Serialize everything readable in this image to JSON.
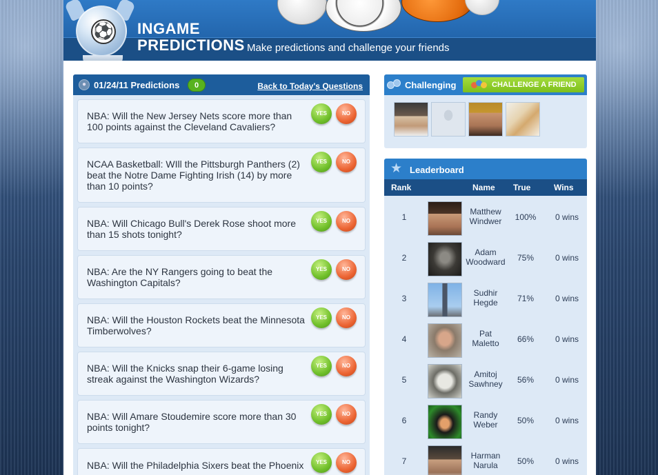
{
  "header": {
    "title_line1": "INGAME",
    "title_line2": "PREDICTIONS",
    "tagline": "Make predictions and challenge your friends"
  },
  "predictions": {
    "date_title": "01/24/11 Predictions",
    "count": "0",
    "back_link": "Back to Today's Questions",
    "yes_label": "YES",
    "no_label": "NO",
    "questions": [
      {
        "text": "NBA: Will the New Jersey Nets score more than 100 points against the Cleveland Cavaliers?"
      },
      {
        "text": "NCAA Basketball: WIll the Pittsburgh Panthers (2) beat the Notre Dame Fighting Irish (14) by more than 10 points?"
      },
      {
        "text": "NBA: Will Chicago Bull's Derek Rose shoot more than 15 shots tonight?"
      },
      {
        "text": "NBA: Are the NY Rangers going to beat the Washington Capitals?"
      },
      {
        "text": "NBA: Will the Houston Rockets beat the Minnesota Timberwolves?"
      },
      {
        "text": "NBA: Will the Knicks snap their 6-game losing streak against the Washington Wizards?"
      },
      {
        "text": "NBA: Will Amare Stoudemire score more than 30 points tonight?"
      },
      {
        "text": "NBA: Will the Philadelphia Sixers beat the Phoenix"
      }
    ]
  },
  "challenging": {
    "title": "Challenging",
    "button": "CHALLENGE A FRIEND",
    "friends": [
      "friend-1",
      "friend-2",
      "friend-3",
      "friend-4"
    ]
  },
  "leaderboard": {
    "title": "Leaderboard",
    "columns": {
      "rank": "Rank",
      "name": "Name",
      "true": "True",
      "wins": "Wins"
    },
    "rows": [
      {
        "rank": "1",
        "name": "Matthew Windwer",
        "pct": "100%",
        "wins": "0 wins"
      },
      {
        "rank": "2",
        "name": "Adam Woodward",
        "pct": "75%",
        "wins": "0 wins"
      },
      {
        "rank": "3",
        "name": "Sudhir Hegde",
        "pct": "71%",
        "wins": "0 wins"
      },
      {
        "rank": "4",
        "name": "Pat Maletto",
        "pct": "66%",
        "wins": "0 wins"
      },
      {
        "rank": "5",
        "name": "Amitoj Sawhney",
        "pct": "56%",
        "wins": "0 wins"
      },
      {
        "rank": "6",
        "name": "Randy Weber",
        "pct": "50%",
        "wins": "0 wins"
      },
      {
        "rank": "7",
        "name": "Harman Narula",
        "pct": "50%",
        "wins": "0 wins"
      }
    ]
  },
  "colors": {
    "header_blue": "#2366ad",
    "panel_bg": "#dde9f6",
    "yes_green": "#71c02b",
    "no_orange": "#ec6534",
    "accent_green": "#7dbf1c"
  }
}
